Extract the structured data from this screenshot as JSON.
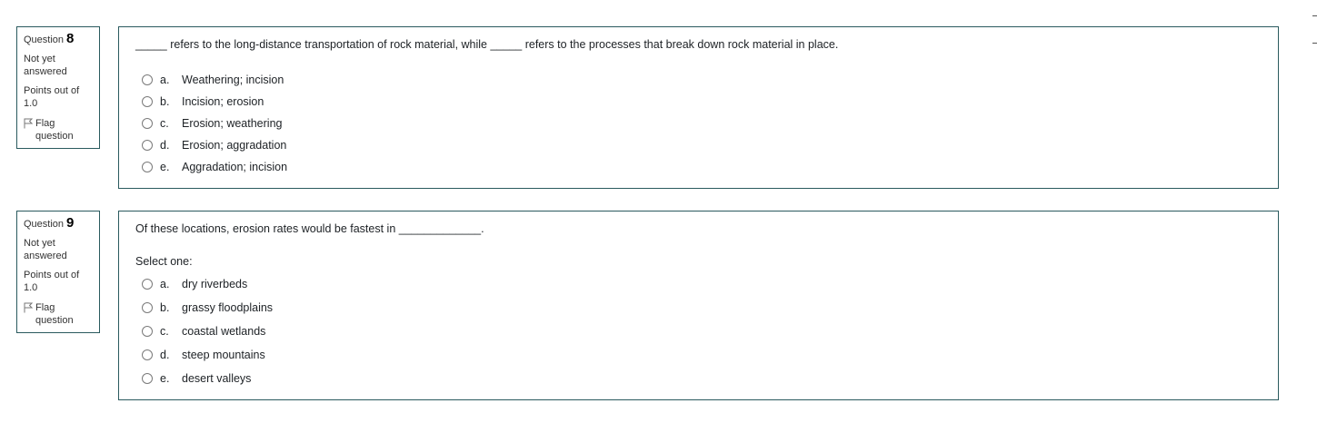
{
  "questions": [
    {
      "label": "Question",
      "number": "8",
      "state": "Not yet answered",
      "grade": "Points out of 1.0",
      "flag": "Flag question",
      "text": "_____ refers to the long-distance transportation of rock material, while _____ refers to the processes that break down rock material in place.",
      "prompt": "",
      "answers": [
        {
          "letter": "a.",
          "text": "Weathering; incision"
        },
        {
          "letter": "b.",
          "text": "Incision; erosion"
        },
        {
          "letter": "c.",
          "text": "Erosion; weathering"
        },
        {
          "letter": "d.",
          "text": "Erosion; aggradation"
        },
        {
          "letter": "e.",
          "text": "Aggradation; incision"
        }
      ]
    },
    {
      "label": "Question",
      "number": "9",
      "state": "Not yet answered",
      "grade": "Points out of 1.0",
      "flag": "Flag question",
      "text": "Of these locations, erosion rates would be fastest in _____________.",
      "prompt": "Select one:",
      "answers": [
        {
          "letter": "a.",
          "text": "dry riverbeds"
        },
        {
          "letter": "b.",
          "text": "grassy floodplains"
        },
        {
          "letter": "c.",
          "text": "coastal wetlands"
        },
        {
          "letter": "d.",
          "text": "steep mountains"
        },
        {
          "letter": "e.",
          "text": "desert valleys"
        }
      ]
    }
  ]
}
